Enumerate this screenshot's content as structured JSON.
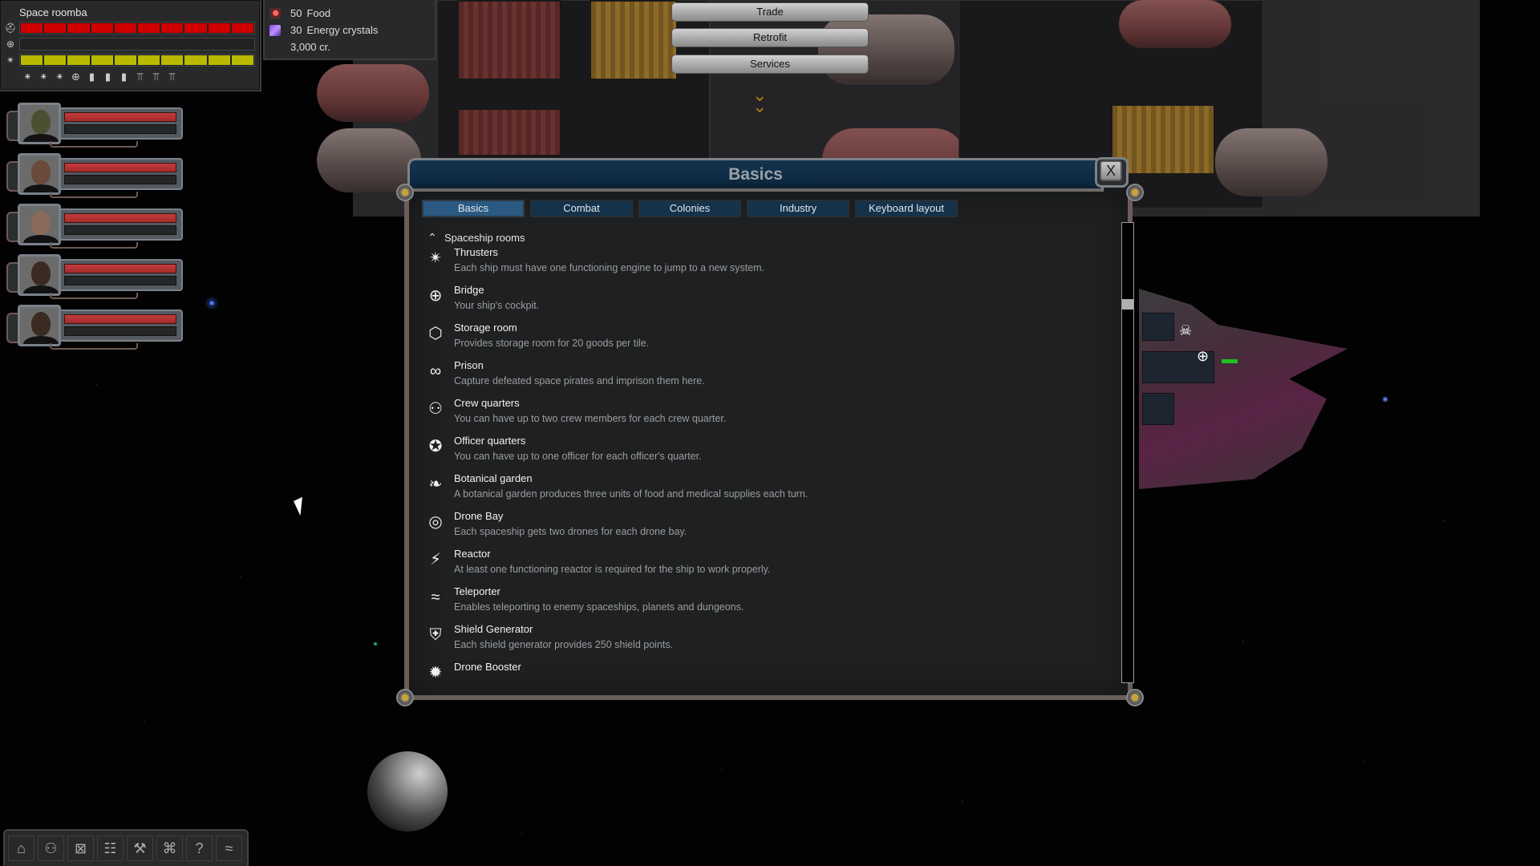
{
  "ship_status": {
    "name": "Space roomba",
    "hull": {
      "icon": "hull-icon",
      "segments_total": 10,
      "segments_filled": 10,
      "color": "#d10000"
    },
    "shield": {
      "icon": "shield-icon",
      "segments_total": 10,
      "segments_filled": 0
    },
    "fuel": {
      "icon": "thruster-icon",
      "segments_total": 10,
      "segments_filled": 10,
      "color": "#b9b900"
    },
    "rooms": [
      {
        "icon": "thruster-icon",
        "glyph": "✴"
      },
      {
        "icon": "thruster-icon",
        "glyph": "✴"
      },
      {
        "icon": "thruster-icon",
        "glyph": "✴"
      },
      {
        "icon": "bridge-icon",
        "glyph": "⊕"
      },
      {
        "icon": "reactor-icon",
        "glyph": "▮"
      },
      {
        "icon": "reactor-icon",
        "glyph": "▮"
      },
      {
        "icon": "reactor-icon",
        "glyph": "▮"
      },
      {
        "icon": "turret-icon",
        "glyph": "⫪"
      },
      {
        "icon": "turret-icon",
        "glyph": "⫪"
      },
      {
        "icon": "turret-icon",
        "glyph": "⫪"
      }
    ]
  },
  "resources": {
    "food": {
      "amount": "50",
      "label": "Food"
    },
    "energy": {
      "amount": "30",
      "label": "Energy crystals"
    },
    "credits": "3,000 cr."
  },
  "station_menu": {
    "trade": "Trade",
    "retrofit": "Retrofit",
    "services": "Services"
  },
  "crew": [
    {
      "skin": "#4c5032",
      "health": 1.0
    },
    {
      "skin": "#6a4a3a",
      "health": 1.0
    },
    {
      "skin": "#8a6a5a",
      "health": 1.0
    },
    {
      "skin": "#3a2a22",
      "health": 1.0
    },
    {
      "skin": "#3a2a22",
      "health": 1.0
    }
  ],
  "toolbar": [
    {
      "icon": "ship-icon",
      "glyph": "⌂"
    },
    {
      "icon": "crew-icon",
      "glyph": "⚇"
    },
    {
      "icon": "cargo-icon",
      "glyph": "⊠"
    },
    {
      "icon": "map-icon",
      "glyph": "☷"
    },
    {
      "icon": "tools-icon",
      "glyph": "⚒"
    },
    {
      "icon": "tech-icon",
      "glyph": "⌘"
    },
    {
      "icon": "help-icon",
      "glyph": "?"
    },
    {
      "icon": "teleport-icon",
      "glyph": "≈"
    }
  ],
  "dialog": {
    "title": "Basics",
    "close_label": "X",
    "tabs": [
      {
        "label": "Basics",
        "active": true
      },
      {
        "label": "Combat",
        "active": false
      },
      {
        "label": "Colonies",
        "active": false
      },
      {
        "label": "Industry",
        "active": false
      },
      {
        "label": "Keyboard layout",
        "active": false
      }
    ],
    "section": {
      "label": "Spaceship rooms",
      "expanded": true,
      "items": [
        {
          "icon": "thruster-icon",
          "glyph": "✴",
          "name": "Thrusters",
          "desc": "Each ship must have one functioning engine to jump to a new system."
        },
        {
          "icon": "bridge-icon",
          "glyph": "⊕",
          "name": "Bridge",
          "desc": "Your ship's cockpit."
        },
        {
          "icon": "storage-icon",
          "glyph": "⬡",
          "name": "Storage room",
          "desc": "Provides storage room for 20 goods per tile."
        },
        {
          "icon": "handcuffs-icon",
          "glyph": "∞",
          "name": "Prison",
          "desc": "Capture defeated space pirates and imprison them here."
        },
        {
          "icon": "crew-quarters-icon",
          "glyph": "⚇",
          "name": "Crew quarters",
          "desc": "You can have up to two crew members for each crew quarter."
        },
        {
          "icon": "officer-badge-icon",
          "glyph": "✪",
          "name": "Officer quarters",
          "desc": "You can have up to one officer for each officer's quarter."
        },
        {
          "icon": "carrot-icon",
          "glyph": "❧",
          "name": "Botanical garden",
          "desc": "A botanical garden produces three units of food and medical supplies each turn."
        },
        {
          "icon": "drone-bay-icon",
          "glyph": "◎",
          "name": "Drone Bay",
          "desc": "Each spaceship gets two drones for each drone bay."
        },
        {
          "icon": "reactor-icon",
          "glyph": "⚡",
          "name": "Reactor",
          "desc": "At least one functioning reactor is required for the ship to work properly."
        },
        {
          "icon": "teleporter-icon",
          "glyph": "≈",
          "name": "Teleporter",
          "desc": "Enables teleporting to enemy spaceships, planets and dungeons."
        },
        {
          "icon": "shield-generator-icon",
          "glyph": "⛨",
          "name": "Shield Generator",
          "desc": "Each shield generator provides 250 shield points."
        },
        {
          "icon": "drone-booster-icon",
          "glyph": "✹",
          "name": "Drone Booster",
          "desc": ""
        }
      ]
    },
    "scroll_position": 0.17
  }
}
